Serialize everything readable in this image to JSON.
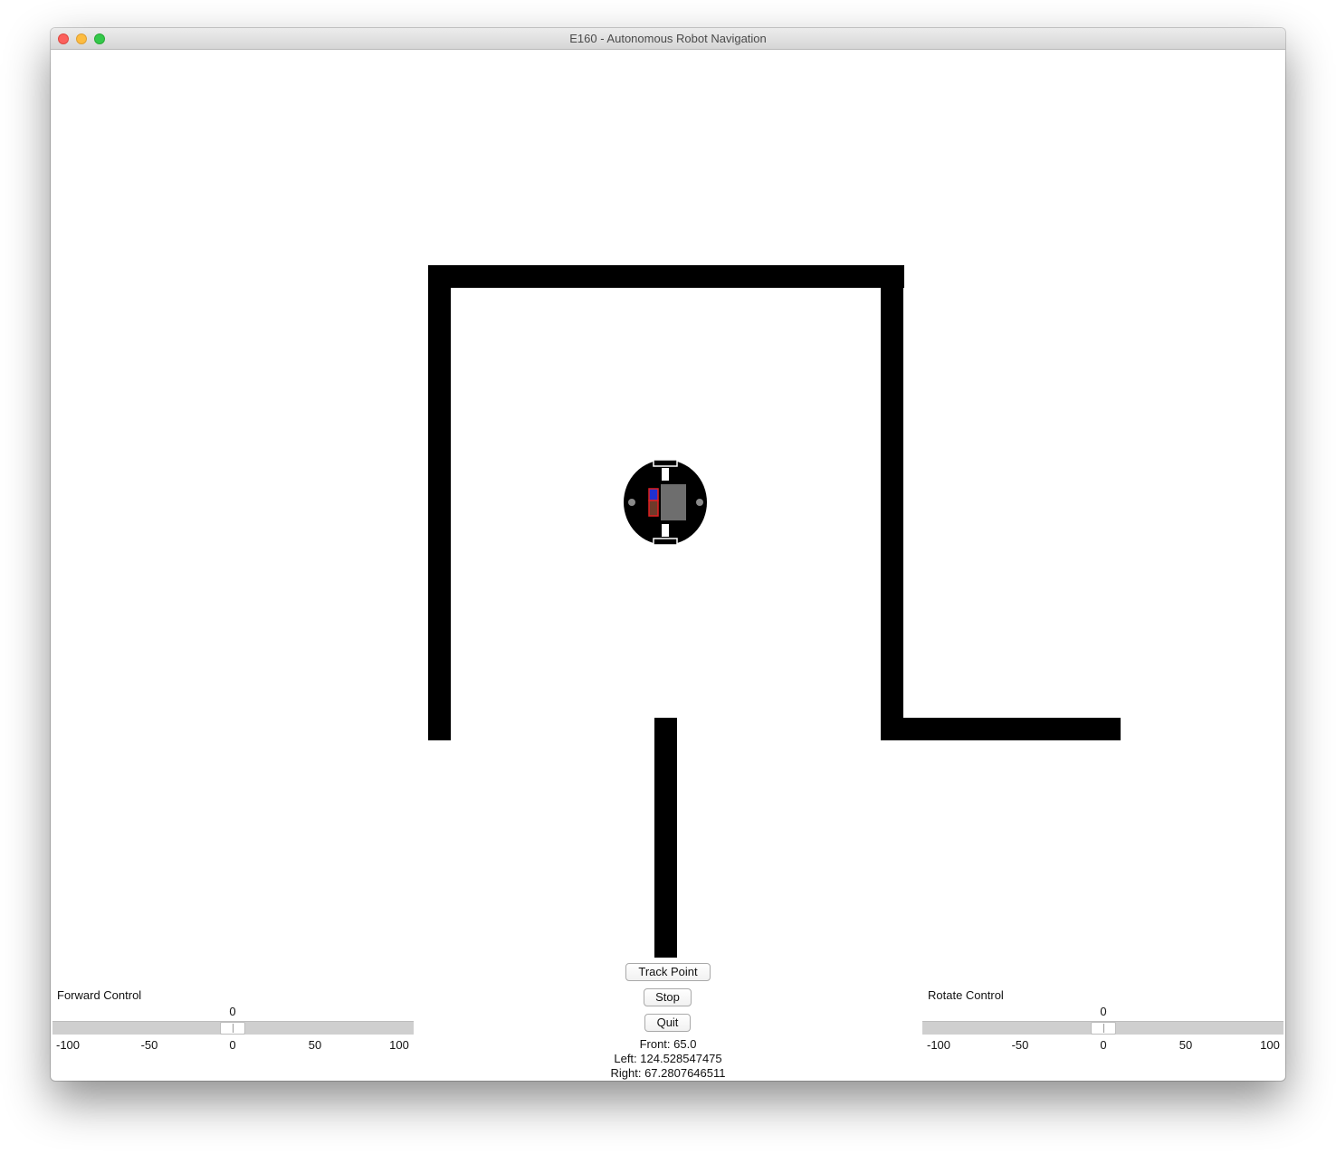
{
  "window": {
    "title": "E160 - Autonomous Robot Navigation"
  },
  "buttons": {
    "track_point": "Track Point",
    "stop": "Stop",
    "quit": "Quit"
  },
  "sensors": {
    "front": "Front: 65.0",
    "left": "Left: 124.528547475",
    "right": "Right: 67.2807646511"
  },
  "forward_control": {
    "label": "Forward Control",
    "value": "0",
    "ticks": [
      "-100",
      "-50",
      "0",
      "50",
      "100"
    ]
  },
  "rotate_control": {
    "label": "Rotate Control",
    "value": "0",
    "ticks": [
      "-100",
      "-50",
      "0",
      "50",
      "100"
    ]
  },
  "colors": {
    "wall": "#000000",
    "robot_body": "#000000",
    "robot_board": "#6e6e6e",
    "robot_blue_marker": "#2030d0",
    "robot_red_marker": "#e02020"
  }
}
